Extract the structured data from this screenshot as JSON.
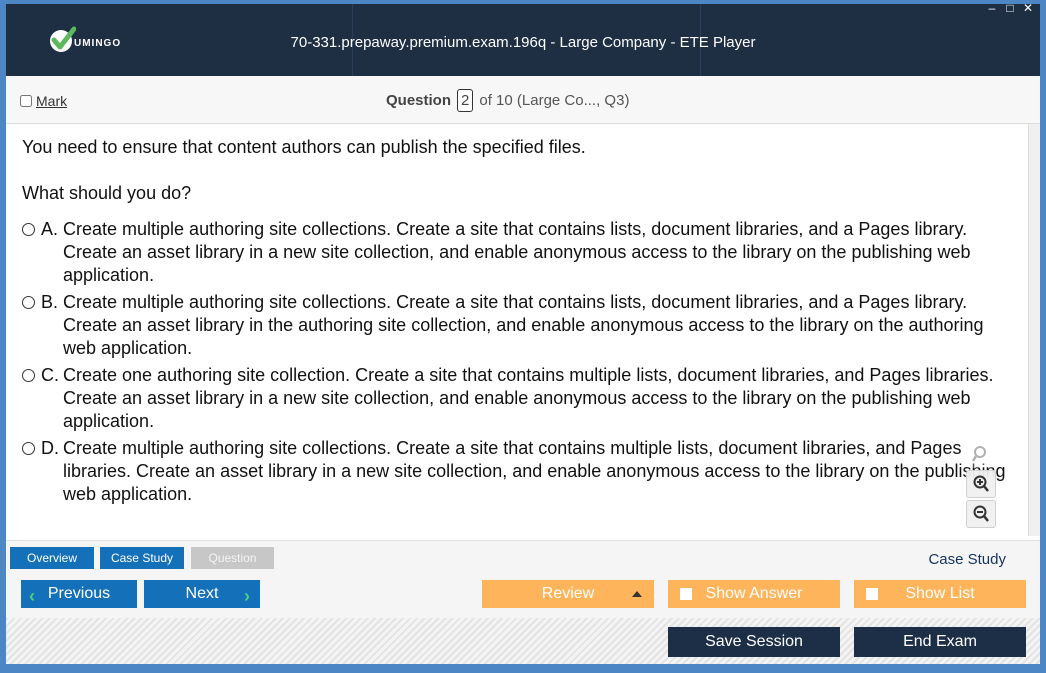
{
  "window": {
    "title": "70-331.prepaway.premium.exam.196q - Large Company - ETE Player",
    "logo_text": "UMINGO",
    "controls": [
      "–",
      "□",
      "✕"
    ]
  },
  "header": {
    "mark_label": "Mark",
    "question_label": "Question",
    "question_number": "2",
    "question_of": "of 10 (Large Co..., Q3)"
  },
  "question": {
    "line1": "You need to ensure that content authors can publish the specified files.",
    "line2": "What should you do?",
    "options": [
      {
        "letter": "A.",
        "text": "Create multiple authoring site collections. Create a site that contains lists, document libraries, and a Pages library. Create an asset library in a new site collection, and enable anonymous access to the library on the publishing web application."
      },
      {
        "letter": "B.",
        "text": "Create multiple authoring site collections. Create a site that contains lists, document libraries, and a Pages library. Create an asset library in the authoring site collection, and enable anonymous access to the library on the authoring web application."
      },
      {
        "letter": "C.",
        "text": "Create one authoring site collection. Create a site that contains multiple lists, document libraries, and Pages libraries. Create an asset library in a new site collection, and enable anonymous access to the library on the publishing web application."
      },
      {
        "letter": "D.",
        "text": "Create multiple authoring site collections. Create a site that contains multiple lists, document libraries, and Pages libraries. Create an asset library in a new site collection, and enable anonymous access to the library on the publishing web application."
      }
    ]
  },
  "zoom": [
    "search-icon",
    "zoom-in-icon",
    "zoom-out-icon"
  ],
  "tabs": {
    "overview": "Overview",
    "case_study": "Case Study",
    "question": "Question",
    "case_study_link": "Case Study"
  },
  "nav": {
    "previous": "Previous",
    "next": "Next",
    "review": "Review",
    "show_answer": "Show Answer",
    "show_list": "Show List"
  },
  "footer": {
    "save_session": "Save Session",
    "end_exam": "End Exam"
  },
  "colors": {
    "titlebar": "#1e2e43",
    "frame": "#4d86c4",
    "accent_blue": "#1470b8",
    "orange": "#fdb45a",
    "dark_button": "#1d2f47",
    "check_green": "#5cb85c"
  }
}
